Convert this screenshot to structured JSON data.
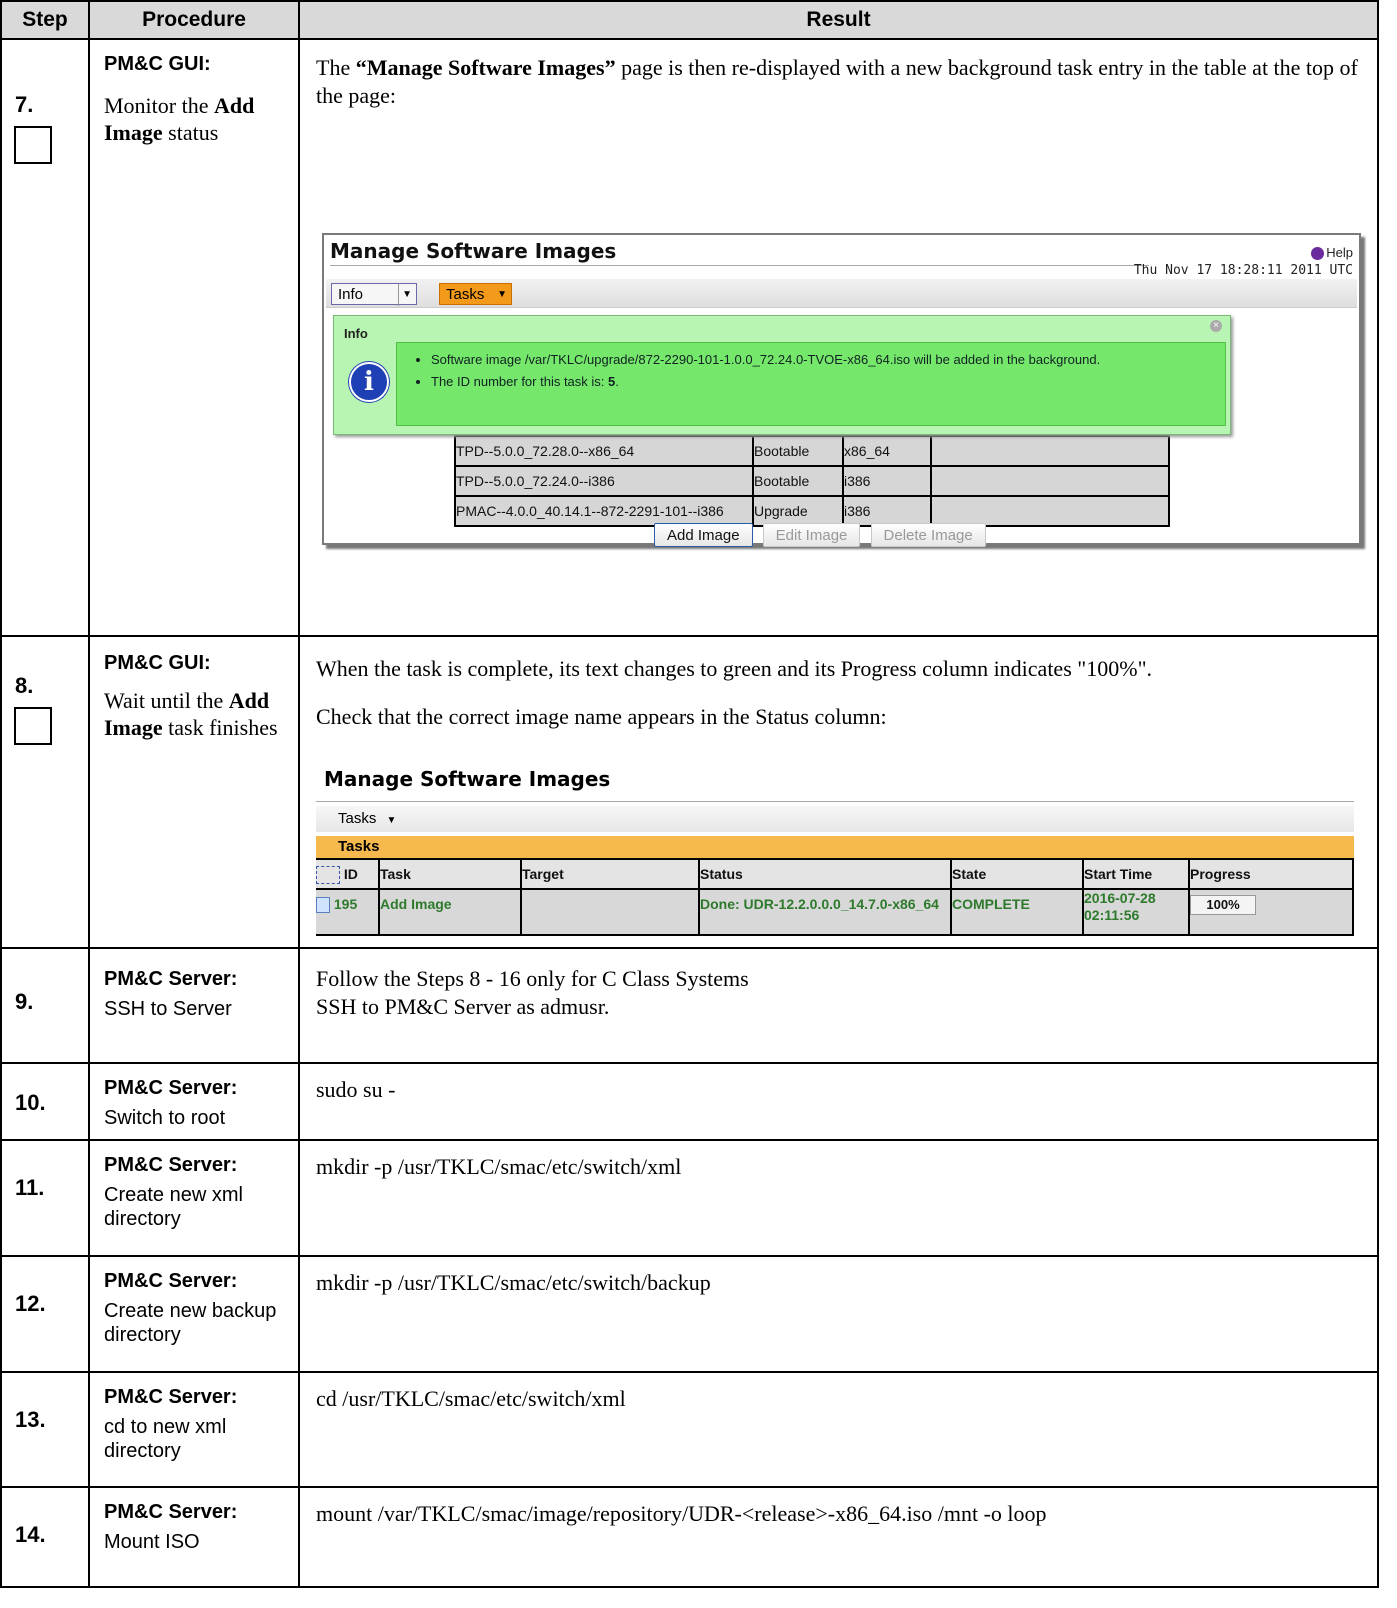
{
  "header": {
    "step": "Step",
    "procedure": "Procedure",
    "result": "Result"
  },
  "steps": [
    {
      "num": "7.",
      "proc_heading": "PM&C GUI:",
      "proc_pre": "Monitor the ",
      "proc_bold": "Add Image",
      "proc_post": " status",
      "result_pre": "The ",
      "result_bold": "“Manage Software Images”",
      "result_post": " page is then re-displayed with a new background task entry in the table at the top of the page:"
    },
    {
      "num": "8.",
      "proc_heading": "PM&C GUI:",
      "proc_pre": "Wait until the ",
      "proc_bold": "Add Image",
      "proc_post": " task finishes",
      "result_line1": "When the task is complete, its text changes to green and its Progress column indicates \"100%\".",
      "result_line2": "Check that the correct image name appears in the Status column:"
    },
    {
      "num": "9.",
      "proc_heading": "PM&C Server:",
      "proc_desc": "SSH to Server",
      "result_line1": "Follow the Steps 8 - 16 only for C Class Systems",
      "result_line2": "SSH to PM&C Server as admusr."
    },
    {
      "num": "10.",
      "proc_heading": "PM&C Server:",
      "proc_desc": "Switch to root",
      "result_line1": "sudo su -"
    },
    {
      "num": "11.",
      "proc_heading": "PM&C Server:",
      "proc_desc": "Create new xml directory",
      "result_line1": "mkdir -p /usr/TKLC/smac/etc/switch/xml"
    },
    {
      "num": "12.",
      "proc_heading": "PM&C Server:",
      "proc_desc": "Create new backup directory",
      "result_line1": "mkdir -p /usr/TKLC/smac/etc/switch/backup"
    },
    {
      "num": "13.",
      "proc_heading": "PM&C Server:",
      "proc_desc": "cd to new xml directory",
      "result_line1": "cd /usr/TKLC/smac/etc/switch/xml"
    },
    {
      "num": "14.",
      "proc_heading": "PM&C Server:",
      "proc_desc": "Mount ISO",
      "result_line1": "mount /var/TKLC/smac/image/repository/UDR-<release>-x86_64.iso /mnt -o loop"
    }
  ],
  "shot1": {
    "title": "Manage Software Images",
    "help": "Help",
    "datetime": "Thu Nov 17 18:28:11 2011 UTC",
    "info_menu": "Info",
    "tasks_menu": "Tasks",
    "info_title": "Info",
    "msg1": "Software image /var/TKLC/upgrade/872-2290-101-1.0.0_72.24.0-TVOE-x86_64.iso will be added in the background.",
    "msg2_pre": "The ID number for this task is: ",
    "msg2_id": "5",
    "msg2_post": ".",
    "rows": [
      {
        "name": "TPD--5.0.0_72.28.0--x86_64",
        "type": "Bootable",
        "arch": "x86_64"
      },
      {
        "name": "TPD--5.0.0_72.24.0--i386",
        "type": "Bootable",
        "arch": "i386"
      },
      {
        "name": "PMAC--4.0.0_40.14.1--872-2291-101--i386",
        "type": "Upgrade",
        "arch": "i386"
      }
    ],
    "btn_add": "Add Image",
    "btn_edit": "Edit Image",
    "btn_delete": "Delete Image"
  },
  "shot2": {
    "title": "Manage Software Images",
    "tasks_menu": "Tasks",
    "tasks_header": "Tasks",
    "cols": {
      "id": "ID",
      "task": "Task",
      "target": "Target",
      "status": "Status",
      "state": "State",
      "start": "Start Time",
      "progress": "Progress"
    },
    "row": {
      "id": "195",
      "task": "Add Image",
      "target": "",
      "status": "Done: UDR-12.2.0.0.0_14.7.0-x86_64",
      "state": "COMPLETE",
      "start_date": "2016-07-28",
      "start_time": "02:11:56",
      "progress": "100%"
    }
  }
}
